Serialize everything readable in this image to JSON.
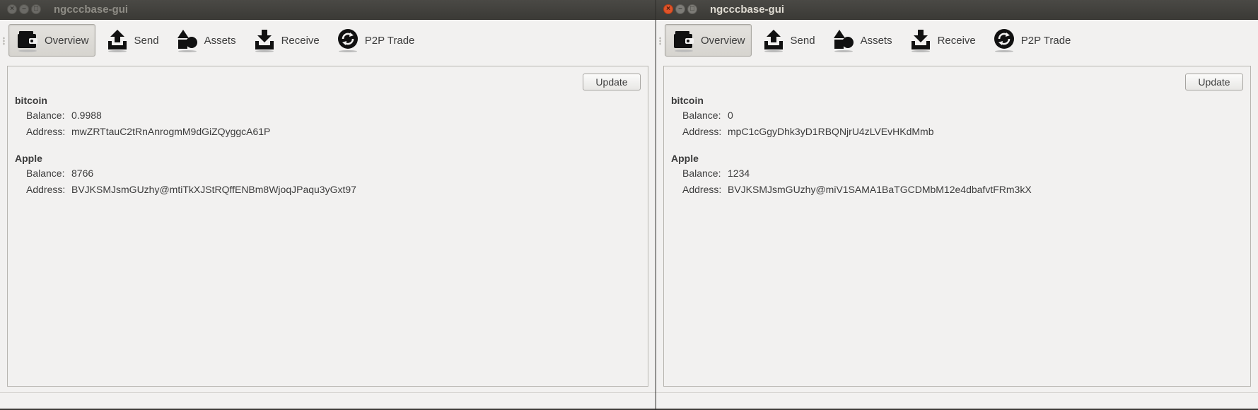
{
  "windows": [
    {
      "title": "ngcccbase-gui",
      "toolbar": {
        "overview": "Overview",
        "send": "Send",
        "assets": "Assets",
        "receive": "Receive",
        "p2p_trade": "P2P Trade"
      },
      "update_label": "Update",
      "assets_list": [
        {
          "name": "bitcoin",
          "balance_label": "Balance:",
          "balance": "0.9988",
          "address_label": "Address:",
          "address": "mwZRTtauC2tRnAnrogmM9dGiZQyggcA61P"
        },
        {
          "name": "Apple",
          "balance_label": "Balance:",
          "balance": "8766",
          "address_label": "Address:",
          "address": "BVJKSMJsmGUzhy@mtiTkXJStRQffENBm8WjoqJPaqu3yGxt97"
        }
      ]
    },
    {
      "title": "ngcccbase-gui",
      "toolbar": {
        "overview": "Overview",
        "send": "Send",
        "assets": "Assets",
        "receive": "Receive",
        "p2p_trade": "P2P Trade"
      },
      "update_label": "Update",
      "assets_list": [
        {
          "name": "bitcoin",
          "balance_label": "Balance:",
          "balance": "0",
          "address_label": "Address:",
          "address": "mpC1cGgyDhk3yD1RBQNjrU4zLVEvHKdMmb"
        },
        {
          "name": "Apple",
          "balance_label": "Balance:",
          "balance": "1234",
          "address_label": "Address:",
          "address": "BVJKSMJsmGUzhy@miV1SAMA1BaTGCDMbM12e4dbafvtFRm3kX"
        }
      ]
    }
  ],
  "icons": {
    "close": "close-icon",
    "minimize": "minimize-icon",
    "maximize": "maximize-icon",
    "overview": "wallet-icon",
    "send": "upload-tray-icon",
    "assets": "shapes-icon",
    "receive": "download-tray-icon",
    "p2p_trade": "exchange-icon"
  },
  "colors": {
    "titlebar": "#3b3a36",
    "window_bg": "#f2f1f0",
    "close_active": "#e0542a",
    "text": "#3c3c3c"
  }
}
